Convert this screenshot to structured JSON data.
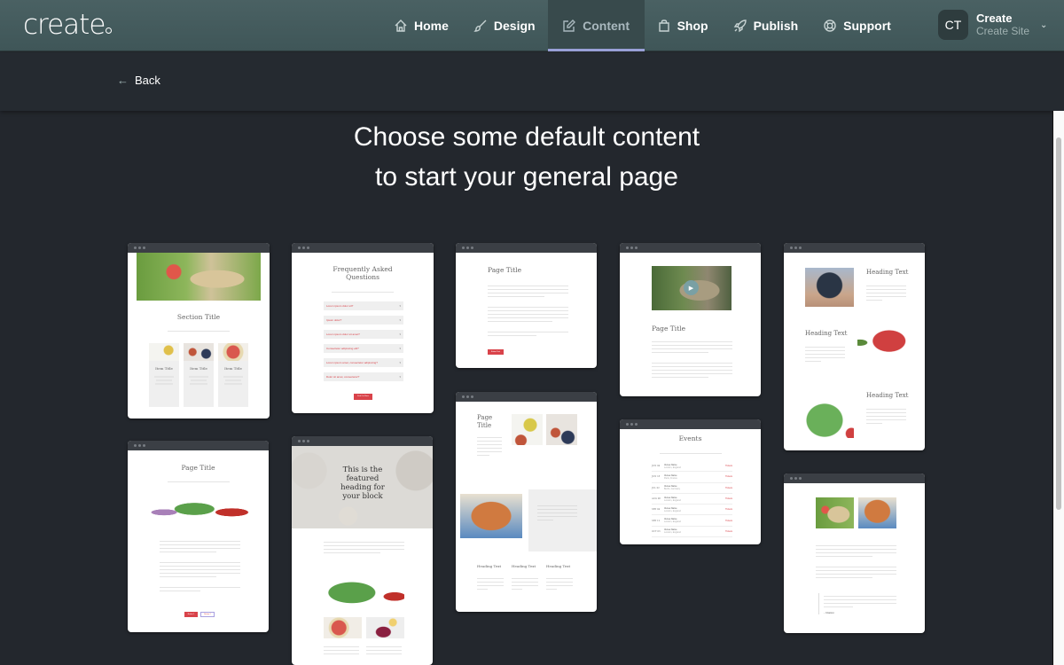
{
  "app": {
    "logo": "create",
    "nav": [
      {
        "label": "Home",
        "icon": "home-icon"
      },
      {
        "label": "Design",
        "icon": "brush-icon"
      },
      {
        "label": "Content",
        "icon": "edit-icon",
        "active": true
      },
      {
        "label": "Shop",
        "icon": "bag-icon"
      },
      {
        "label": "Publish",
        "icon": "rocket-icon"
      },
      {
        "label": "Support",
        "icon": "lifebuoy-icon"
      }
    ],
    "account": {
      "initials": "CT",
      "name": "Create",
      "site": "Create Site"
    }
  },
  "back_label": "Back",
  "heading": {
    "line1": "Choose some default content",
    "line2": "to start your general page"
  },
  "colors": {
    "accent": "#9aa1d8",
    "brand_red": "#d9434a",
    "topbar": "#455c5e"
  },
  "templates": [
    {
      "name": "section-with-items",
      "title": "Section Title",
      "items": [
        "Item Title",
        "Item Title",
        "Item Title"
      ]
    },
    {
      "name": "faq",
      "title": "Frequently Asked Questions",
      "questions": [
        "Lorem ipsum dolor sit?",
        "Ipsum dolor?",
        "Lorem ipsum dolor sit amet?",
        "Consectetur adipiscing elit?",
        "Lorem ipsum amet, consectetur adipiscing?",
        "Dolor sit amet, consectetur?"
      ],
      "button": "Find Out More"
    },
    {
      "name": "page-text",
      "title": "Page Title",
      "button": "Button Text"
    },
    {
      "name": "video-page",
      "title": "Page Title"
    },
    {
      "name": "image-text-alternating",
      "headings": [
        "Heading Text",
        "Heading Text",
        "Heading Text"
      ]
    },
    {
      "name": "page-with-image-buttons",
      "title": "Page Title",
      "buttons": [
        "Button 1",
        "Button 2"
      ]
    },
    {
      "name": "featured-heading",
      "title": "This is the featured heading for your block"
    },
    {
      "name": "gallery-columns",
      "title": "Page Title",
      "headings": [
        "Heading Text",
        "Heading Text",
        "Heading Text"
      ]
    },
    {
      "name": "events",
      "title": "Events",
      "events": [
        {
          "date": "JUN 04",
          "venue": "Venue Name",
          "city": "London, England",
          "link": "Tickets"
        },
        {
          "date": "JUN 18",
          "venue": "Venue Name",
          "city": "Paris, France",
          "link": "Tickets"
        },
        {
          "date": "JUL 02",
          "venue": "Venue Name",
          "city": "Berlin, Germany",
          "link": "Tickets"
        },
        {
          "date": "AUG 08",
          "venue": "Venue Name",
          "city": "London, England",
          "link": "Tickets"
        },
        {
          "date": "SEP 04",
          "venue": "Venue Name",
          "city": "London, England",
          "link": "Tickets"
        },
        {
          "date": "SEP 12",
          "venue": "Venue Name",
          "city": "London, England",
          "link": "Tickets"
        },
        {
          "date": "OCT 03",
          "venue": "Venue Name",
          "city": "London, England",
          "link": "Tickets"
        }
      ]
    },
    {
      "name": "images-quote",
      "quote_author": "- Citation"
    }
  ]
}
